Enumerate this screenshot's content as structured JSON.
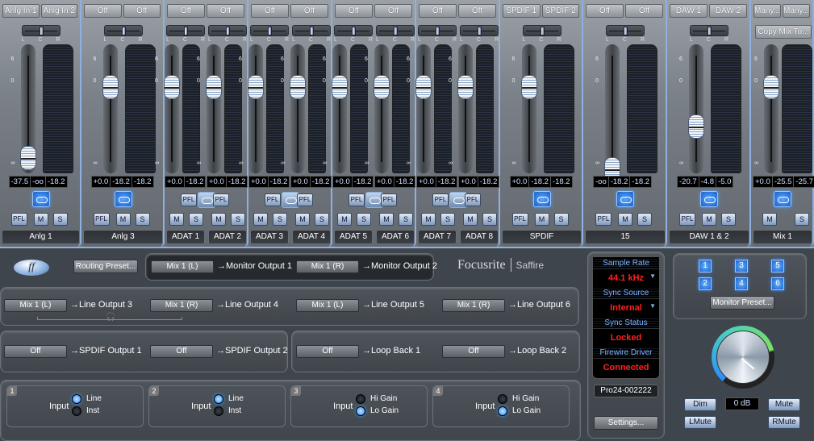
{
  "app": "Focusrite Saffire",
  "channels": [
    {
      "sources": [
        "Anlg In 1",
        "Anlg In 2"
      ],
      "name": "Anlg 1",
      "readouts": [
        "-37.5",
        "-oo",
        "-18.2"
      ],
      "fader_db": -37.5,
      "linked": true,
      "buttons": [
        "PFL",
        "M",
        "S"
      ]
    },
    {
      "sources": [
        "Off",
        "Off"
      ],
      "name": "Anlg 3",
      "readouts": [
        "+0.0",
        "-18.2",
        "-18.2"
      ],
      "fader_db": 0.0,
      "linked": true,
      "buttons": [
        "PFL",
        "M",
        "S"
      ]
    },
    {
      "sources": [
        "Off"
      ],
      "name": "ADAT 1",
      "readouts": [
        "+0.0",
        "-18.2"
      ],
      "fader_db": 0.0,
      "buttons": [
        "PFL",
        "M",
        "S"
      ]
    },
    {
      "sources": [
        "Off"
      ],
      "name": "ADAT 2",
      "readouts": [
        "+0.0",
        "-18.2"
      ],
      "fader_db": 0.0,
      "buttons": [
        "PFL",
        "M",
        "S"
      ]
    },
    {
      "sources": [
        "Off"
      ],
      "name": "ADAT 3",
      "readouts": [
        "+0.0",
        "-18.2"
      ],
      "fader_db": 0.0,
      "buttons": [
        "PFL",
        "M",
        "S"
      ]
    },
    {
      "sources": [
        "Off"
      ],
      "name": "ADAT 4",
      "readouts": [
        "+0.0",
        "-18.2"
      ],
      "fader_db": 0.0,
      "buttons": [
        "PFL",
        "M",
        "S"
      ]
    },
    {
      "sources": [
        "Off"
      ],
      "name": "ADAT 5",
      "readouts": [
        "+0.0",
        "-18.2"
      ],
      "fader_db": 0.0,
      "buttons": [
        "PFL",
        "M",
        "S"
      ]
    },
    {
      "sources": [
        "Off"
      ],
      "name": "ADAT 6",
      "readouts": [
        "+0.0",
        "-18.2"
      ],
      "fader_db": 0.0,
      "buttons": [
        "PFL",
        "M",
        "S"
      ]
    },
    {
      "sources": [
        "Off"
      ],
      "name": "ADAT 7",
      "readouts": [
        "+0.0",
        "-18.2"
      ],
      "fader_db": 0.0,
      "buttons": [
        "PFL",
        "M",
        "S"
      ]
    },
    {
      "sources": [
        "Off"
      ],
      "name": "ADAT 8",
      "readouts": [
        "+0.0",
        "-18.2"
      ],
      "fader_db": 0.0,
      "buttons": [
        "PFL",
        "M",
        "S"
      ]
    },
    {
      "sources": [
        "SPDIF 1",
        "SPDIF 2"
      ],
      "name": "SPDIF",
      "readouts": [
        "+0.0",
        "-18.2",
        "-18.2"
      ],
      "fader_db": 0.0,
      "linked": true,
      "buttons": [
        "PFL",
        "M",
        "S"
      ]
    },
    {
      "sources": [
        "Off",
        "Off"
      ],
      "name": "15",
      "readouts": [
        "-oo",
        "-18.2",
        "-18.2"
      ],
      "fader_db": "-inf",
      "linked": true,
      "buttons": [
        "PFL",
        "M",
        "S"
      ]
    },
    {
      "sources": [
        "DAW 1",
        "DAW 2"
      ],
      "name": "DAW 1 & 2",
      "readouts": [
        "-20.7",
        "-4.8",
        "-5.0"
      ],
      "fader_db": -20.7,
      "linked": true,
      "buttons": [
        "PFL",
        "M",
        "S"
      ]
    },
    {
      "sources": [
        "Many...",
        "Many..."
      ],
      "name": "Mix 1",
      "readouts": [
        "+0.0",
        "-25.5",
        "-25.7"
      ],
      "fader_db": 0.0,
      "linked": true,
      "buttons": [
        "M",
        "S"
      ],
      "copy_mix": "Copy Mix To..."
    }
  ],
  "pan_labels": [
    "L",
    "C",
    "R"
  ],
  "scale_labels": [
    "6",
    "0",
    "∞"
  ],
  "routing": {
    "preset_button": "Routing Preset...",
    "monitor": [
      {
        "source": "Mix 1 (L)",
        "dest": "→Monitor Output 1"
      },
      {
        "source": "Mix 1 (R)",
        "dest": "→Monitor Output 2"
      }
    ],
    "line": [
      {
        "source": "Mix 1 (L)",
        "dest": "→Line Output 3"
      },
      {
        "source": "Mix 1 (R)",
        "dest": "→Line Output 4"
      },
      {
        "source": "Mix 1 (L)",
        "dest": "→Line Output 5"
      },
      {
        "source": "Mix 1 (R)",
        "dest": "→Line Output 6"
      }
    ],
    "spdif": [
      {
        "source": "Off",
        "dest": "→SPDIF Output 1"
      },
      {
        "source": "Off",
        "dest": "→SPDIF Output 2"
      }
    ],
    "loopback": [
      {
        "source": "Off",
        "dest": "→Loop Back 1"
      },
      {
        "source": "Off",
        "dest": "→Loop Back 2"
      }
    ]
  },
  "brand": {
    "name": "Focusrite",
    "product": "Saffire"
  },
  "inputs": [
    {
      "num": "1",
      "label": "Input",
      "options": [
        "Line",
        "Inst"
      ],
      "selected": "Line"
    },
    {
      "num": "2",
      "label": "Input",
      "options": [
        "Line",
        "Inst"
      ],
      "selected": "Line"
    },
    {
      "num": "3",
      "label": "Input",
      "options": [
        "Hi Gain",
        "Lo Gain"
      ],
      "selected": "Lo Gain"
    },
    {
      "num": "4",
      "label": "Input",
      "options": [
        "Hi Gain",
        "Lo Gain"
      ],
      "selected": "Lo Gain"
    }
  ],
  "status": {
    "sample_rate_label": "Sample Rate",
    "sample_rate": "44.1 kHz",
    "sync_source_label": "Sync Source",
    "sync_source": "Internal",
    "sync_status_label": "Sync Status",
    "sync_status": "Locked",
    "driver_label": "Firewire Driver",
    "driver": "Connected",
    "device": "Pro24-002222",
    "settings_button": "Settings..."
  },
  "monitor": {
    "buttons": [
      "1",
      "2",
      "3",
      "4",
      "5",
      "6"
    ],
    "active": [
      "1",
      "2"
    ],
    "preset_button": "Monitor Preset...",
    "level": "0 dB",
    "dim": "Dim",
    "mute": "Mute",
    "lmute": "LMute",
    "rmute": "RMute"
  }
}
